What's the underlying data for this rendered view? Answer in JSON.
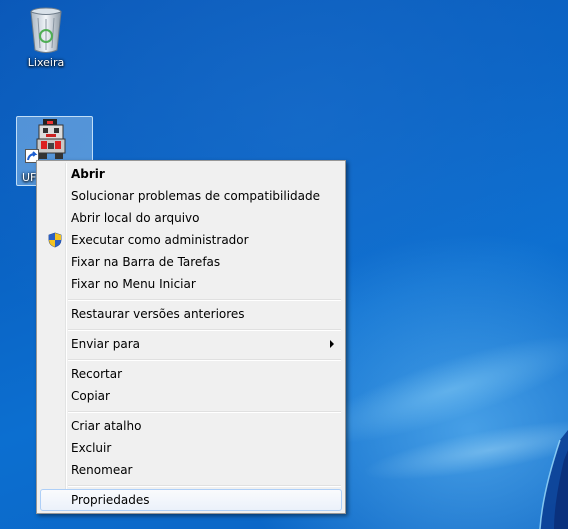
{
  "desktop": {
    "icons": [
      {
        "label": "Lixeira"
      },
      {
        "label": "UF"
      }
    ]
  },
  "context_menu": {
    "items": [
      {
        "label": "Abrir",
        "bold": true
      },
      {
        "label": "Solucionar problemas de compatibilidade"
      },
      {
        "label": "Abrir local do arquivo"
      },
      {
        "label": "Executar como administrador",
        "icon": "uac-shield-icon"
      },
      {
        "label": "Fixar na Barra de Tarefas"
      },
      {
        "label": "Fixar no Menu Iniciar"
      },
      {
        "label": "Restaurar versões anteriores"
      },
      {
        "label": "Enviar para",
        "submenu": true
      },
      {
        "label": "Recortar"
      },
      {
        "label": "Copiar"
      },
      {
        "label": "Criar atalho"
      },
      {
        "label": "Excluir"
      },
      {
        "label": "Renomear"
      },
      {
        "label": "Propriedades",
        "highlighted": true
      }
    ]
  }
}
